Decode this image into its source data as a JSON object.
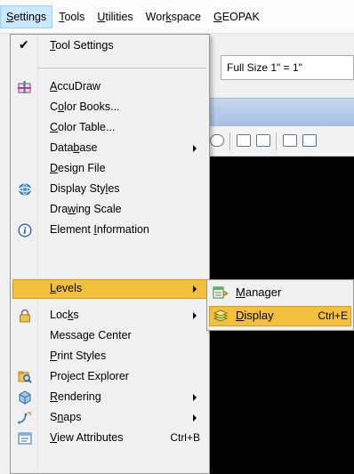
{
  "menubar": {
    "items": [
      {
        "label": "Settings",
        "accel": "S",
        "rest": "ettings"
      },
      {
        "label": "Tools",
        "accel": "T",
        "rest": "ools"
      },
      {
        "label": "Utilities",
        "accel": "U",
        "rest": "tilities"
      },
      {
        "label": "Workspace",
        "pre": "Wor",
        "accel": "k",
        "rest": "space"
      },
      {
        "label": "GEOPAK",
        "accel": "G",
        "rest": "EOPAK"
      }
    ]
  },
  "background": {
    "scale_value": "Full Size 1\" = 1\""
  },
  "settings_menu": {
    "items": [
      {
        "pre": "",
        "accel": "T",
        "rest": "ool Settings",
        "checked": true
      },
      {
        "pre": "",
        "accel": "A",
        "rest": "ccuDraw",
        "icon": "accudraw-icon"
      },
      {
        "pre": "C",
        "accel": "o",
        "rest": "lor Books..."
      },
      {
        "pre": "",
        "accel": "C",
        "rest": "olor Table..."
      },
      {
        "pre": "Data",
        "accel": "b",
        "rest": "ase",
        "submenu": true
      },
      {
        "pre": "",
        "accel": "D",
        "rest": "esign File"
      },
      {
        "pre": "Display Sty",
        "accel": "l",
        "rest": "es",
        "icon": "display-styles-icon"
      },
      {
        "pre": "Dra",
        "accel": "w",
        "rest": "ing Scale"
      },
      {
        "pre": "Element ",
        "accel": "I",
        "rest": "nformation",
        "icon": "info-icon"
      },
      {
        "pre": "",
        "accel": "L",
        "rest": "evels",
        "submenu": true,
        "highlight": true
      },
      {
        "pre": "Loc",
        "accel": "k",
        "rest": "s",
        "submenu": true,
        "icon": "lock-icon"
      },
      {
        "pre": "Message Center",
        "accel": "",
        "rest": ""
      },
      {
        "pre": "",
        "accel": "P",
        "rest": "rint Styles"
      },
      {
        "pre": "Pro",
        "accel": "j",
        "rest": "ect Explorer",
        "icon": "project-explorer-icon"
      },
      {
        "pre": "",
        "accel": "R",
        "rest": "endering",
        "submenu": true,
        "icon": "rendering-icon"
      },
      {
        "pre": "S",
        "accel": "n",
        "rest": "aps",
        "submenu": true,
        "icon": "snaps-icon"
      },
      {
        "pre": "",
        "accel": "V",
        "rest": "iew Attributes",
        "shortcut": "Ctrl+B",
        "icon": "view-attributes-icon"
      }
    ]
  },
  "levels_submenu": {
    "items": [
      {
        "accel": "M",
        "rest": "anager",
        "icon": "level-manager-icon"
      },
      {
        "accel": "D",
        "rest": "isplay",
        "shortcut": "Ctrl+E",
        "icon": "level-display-icon",
        "highlight": true
      }
    ]
  }
}
